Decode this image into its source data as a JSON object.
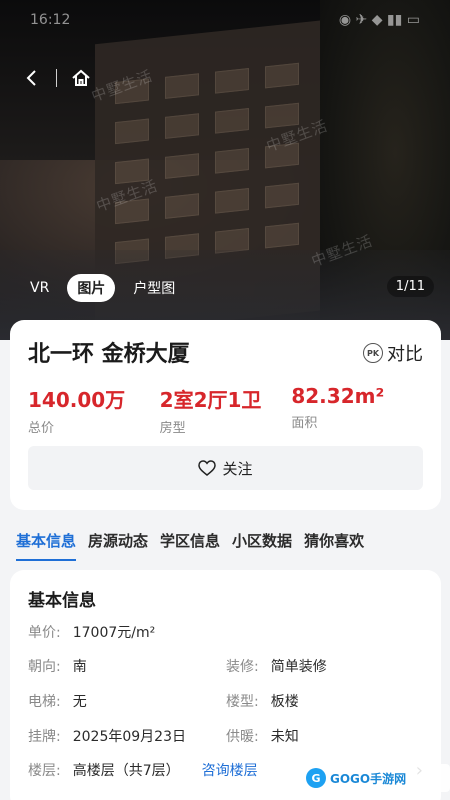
{
  "status": {
    "time": "16:12"
  },
  "media": {
    "tabs": [
      {
        "label": "VR"
      },
      {
        "label": "图片"
      },
      {
        "label": "户型图"
      }
    ],
    "counter": "1/11",
    "watermark": "中墅生活"
  },
  "listing": {
    "title": "北一环 金桥大厦",
    "compare_label": "对比",
    "pk_label": "PK",
    "stats": [
      {
        "value": "140.00万",
        "label": "总价"
      },
      {
        "value": "2室2厅1卫",
        "label": "房型"
      },
      {
        "value": "82.32m²",
        "label": "面积"
      }
    ],
    "follow_label": "关注"
  },
  "section_tabs": [
    {
      "label": "基本信息"
    },
    {
      "label": "房源动态"
    },
    {
      "label": "学区信息"
    },
    {
      "label": "小区数据"
    },
    {
      "label": "猜你喜欢"
    }
  ],
  "basic_info": {
    "title": "基本信息",
    "unit_price_label": "单价:",
    "unit_price": "17007元/m²",
    "rows": [
      {
        "l1": "朝向:",
        "v1": "南",
        "l2": "装修:",
        "v2": "简单装修"
      },
      {
        "l1": "电梯:",
        "v1": "无",
        "l2": "楼型:",
        "v2": "板楼"
      },
      {
        "l1": "挂牌:",
        "v1": "2025年09月23日",
        "l2": "供暖:",
        "v2": "未知"
      }
    ],
    "floor_label": "楼层:",
    "floor_value": "高楼层（共7层）",
    "floor_link": "咨询楼层"
  },
  "logo": {
    "mark": "G",
    "text": "GOGO手游网"
  },
  "colors": {
    "accent": "#1f6fd6",
    "price": "#d7262b"
  }
}
